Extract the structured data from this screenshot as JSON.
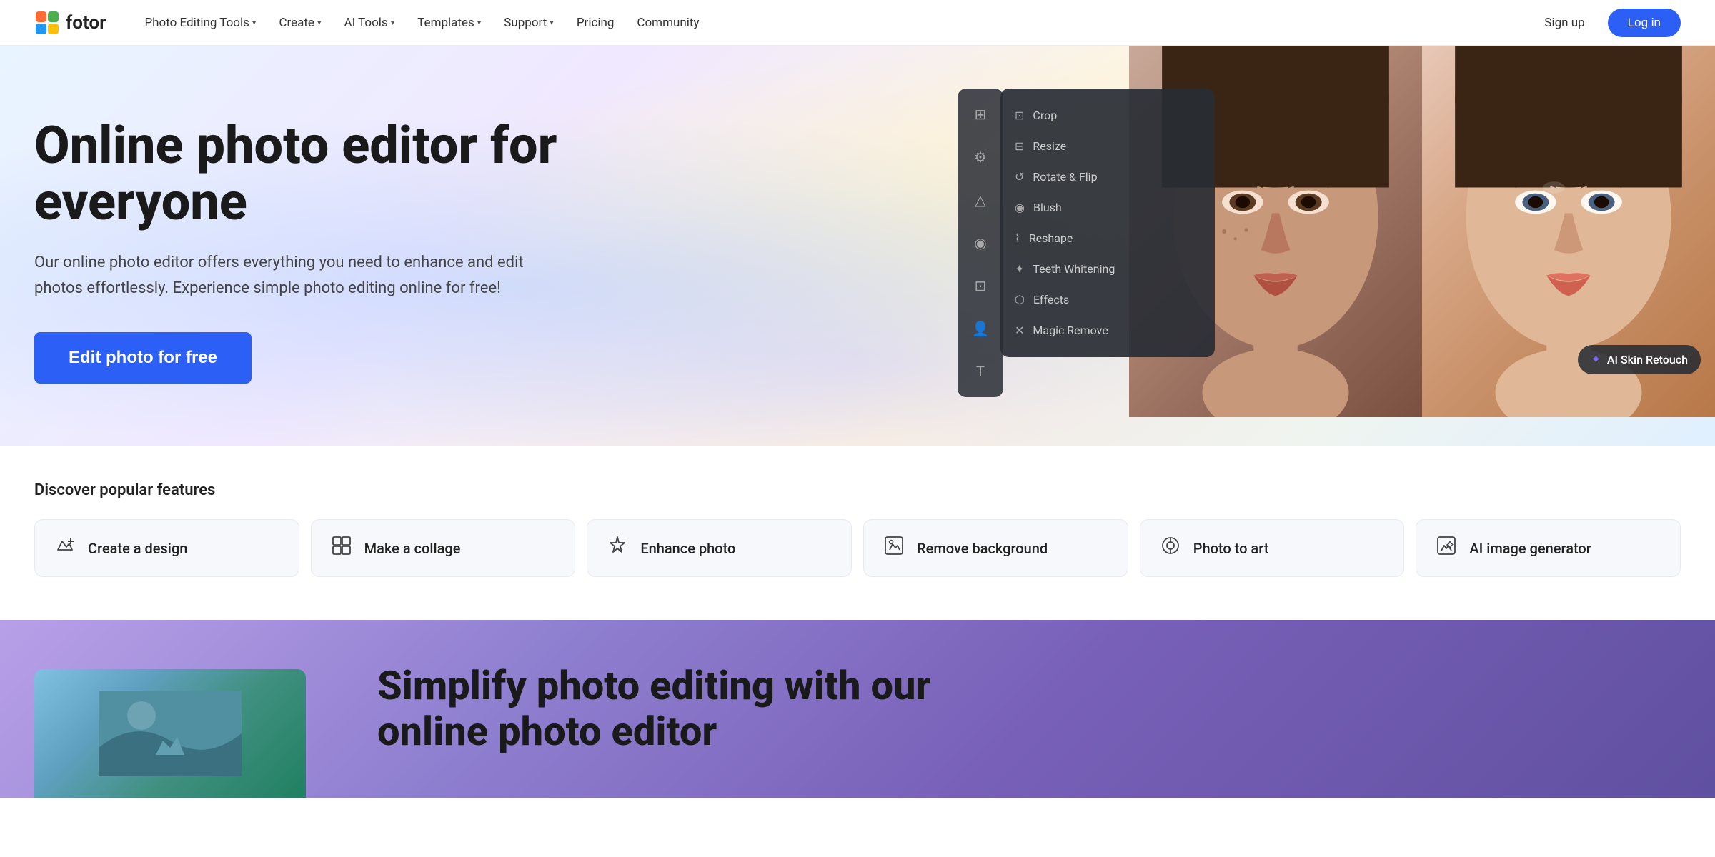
{
  "logo": {
    "text": "fotor"
  },
  "nav": {
    "items": [
      {
        "label": "Photo Editing Tools",
        "hasDropdown": true
      },
      {
        "label": "Create",
        "hasDropdown": true
      },
      {
        "label": "AI Tools",
        "hasDropdown": true
      },
      {
        "label": "Templates",
        "hasDropdown": true
      },
      {
        "label": "Support",
        "hasDropdown": true
      },
      {
        "label": "Pricing",
        "hasDropdown": false
      },
      {
        "label": "Community",
        "hasDropdown": false
      }
    ],
    "signup": "Sign up",
    "login": "Log in"
  },
  "hero": {
    "title": "Online photo editor for everyone",
    "subtitle": "Our online photo editor offers everything you need to enhance and edit photos effortlessly. Experience simple photo editing online for free!",
    "cta": "Edit photo for free",
    "editor": {
      "menu_items": [
        {
          "icon": "⊡",
          "label": "Crop"
        },
        {
          "icon": "⊟",
          "label": "Resize"
        },
        {
          "icon": "↺",
          "label": "Rotate & Flip"
        },
        {
          "icon": "◉",
          "label": "Blush"
        },
        {
          "icon": "⌇",
          "label": "Reshape"
        },
        {
          "icon": "✦",
          "label": "Teeth Whitening"
        },
        {
          "icon": "⬡",
          "label": "Effects"
        },
        {
          "icon": "✕",
          "label": "Magic Remove"
        }
      ]
    },
    "ai_badge": "AI Skin Retouch"
  },
  "features": {
    "title": "Discover popular features",
    "items": [
      {
        "icon": "✂",
        "label": "Create a design"
      },
      {
        "icon": "⊞",
        "label": "Make a collage"
      },
      {
        "icon": "✦",
        "label": "Enhance photo"
      },
      {
        "icon": "⊡",
        "label": "Remove background"
      },
      {
        "icon": "◎",
        "label": "Photo to art"
      },
      {
        "icon": "⊠",
        "label": "AI image generator"
      }
    ]
  },
  "bottom": {
    "title": "Simplify photo editing with our online photo editor"
  }
}
